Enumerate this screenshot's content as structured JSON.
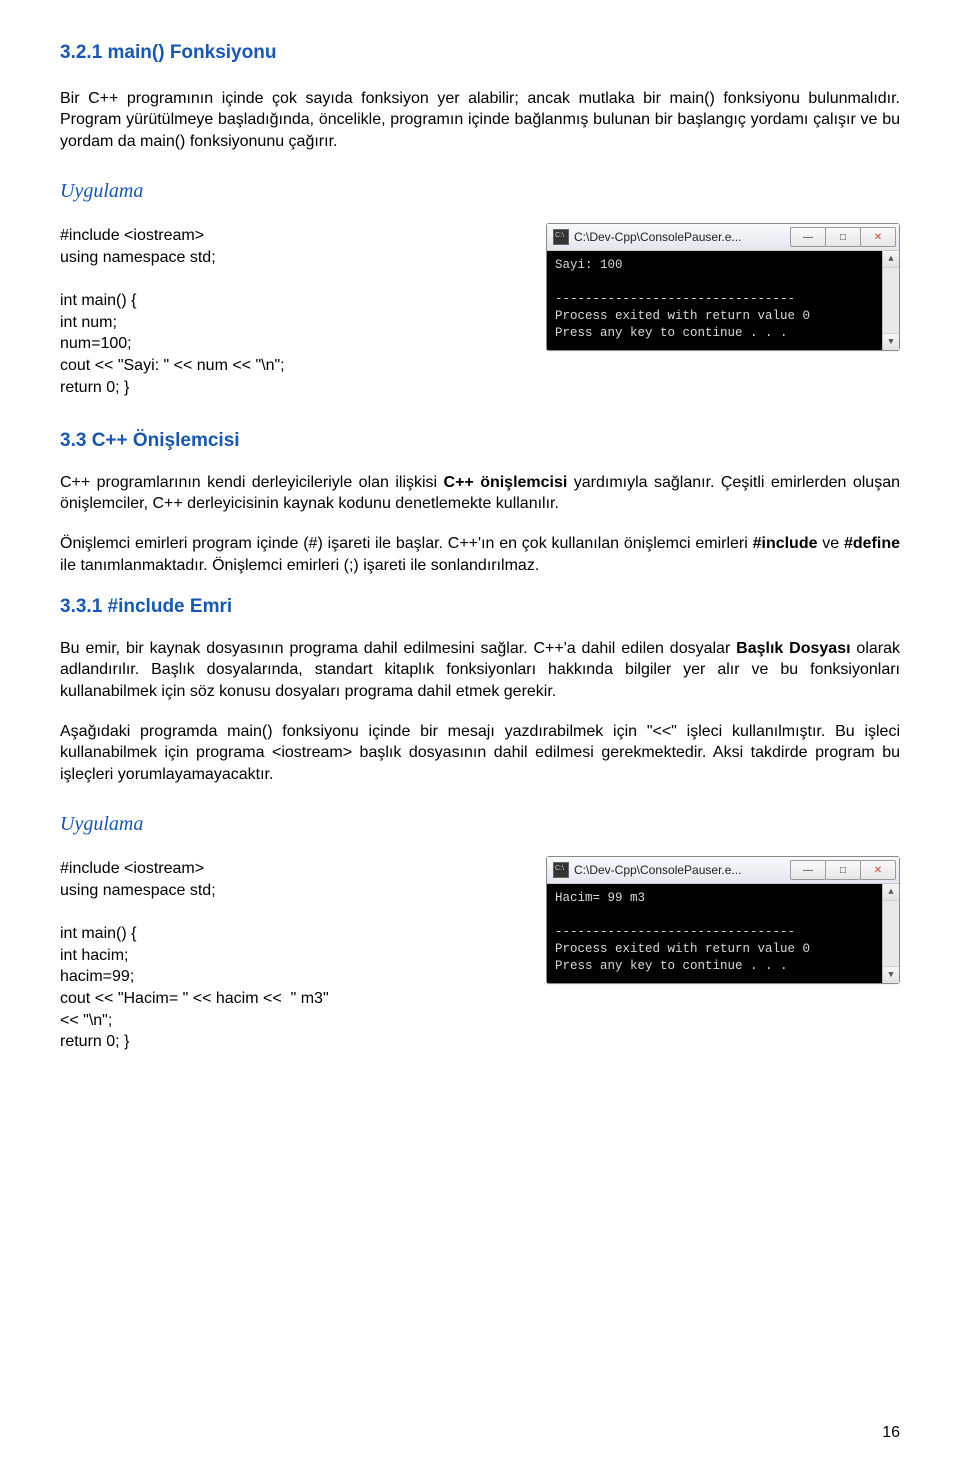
{
  "headings": {
    "h321": "3.2.1 main() Fonksiyonu",
    "uygulama1": "Uygulama",
    "h33": "3.3 C++ Önişlemcisi",
    "h331": "3.3.1 #include Emri",
    "uygulama2": "Uygulama"
  },
  "paragraphs": {
    "p1": "Bir C++ programının içinde çok sayıda fonksiyon yer alabilir; ancak mutlaka bir main() fonksiyonu bulunmalıdır. Program yürütülmeye başladığında, öncelikle, programın içinde bağlanmış bulunan bir başlangıç yordamı çalışır ve bu yordam da main() fonksiyonunu çağırır.",
    "p2a": "C++ programlarının kendi derleyicileriyle olan ilişkisi ",
    "p2b_bold": "C++ önişlemcisi",
    "p2c": " yardımıyla sağlanır. Çeşitli emirlerden oluşan önişlemciler, C++ derleyicisinin kaynak kodunu denetlemekte kullanılır.",
    "p3a": "Önişlemci emirleri program içinde (#) işareti ile başlar. C++'ın en çok kullanılan önişlemci emirleri ",
    "p3b_bold": "#include",
    "p3c": " ve ",
    "p3d_bold": "#define",
    "p3e": " ile tanımlanmaktadır. Önişlemci emirleri (;) işareti ile sonlandırılmaz.",
    "p4a": "Bu emir, bir kaynak dosyasının programa dahil edilmesini sağlar. C++'a dahil edilen dosyalar ",
    "p4b_bold": "Başlık Dosyası",
    "p4c": " olarak adlandırılır. Başlık dosyalarında, standart kitaplık fonksiyonları hakkında bilgiler yer alır ve bu fonksiyonları kullanabilmek için söz konusu dosyaları programa dahil etmek gerekir.",
    "p5": "Aşağıdaki programda main() fonksiyonu içinde bir mesajı yazdırabilmek için \"<<\" işleci kullanılmıştır. Bu işleci kullanabilmek için programa <iostream> başlık dosyasının dahil edilmesi gerekmektedir. Aksi takdirde program bu işleçleri yorumlayamayacaktır."
  },
  "code1": "#include <iostream>\nusing namespace std;\n\nint main() {\nint num;\nnum=100;\ncout << \"Sayi: \" << num << \"\\n\";\nreturn 0; }",
  "code2": "#include <iostream>\nusing namespace std;\n\nint main() {\nint hacim;\nhacim=99;\ncout << \"Hacim= \" << hacim <<  \" m3\"\n<< \"\\n\";\nreturn 0; }",
  "console1": {
    "title": "C:\\Dev-Cpp\\ConsolePauser.e...",
    "body": "Sayi: 100\n\n--------------------------------\nProcess exited with return value 0\nPress any key to continue . . ."
  },
  "console2": {
    "title": "C:\\Dev-Cpp\\ConsolePauser.e...",
    "body": "Hacim= 99 m3\n\n--------------------------------\nProcess exited with return value 0\nPress any key to continue . . ."
  },
  "page_number": "16"
}
